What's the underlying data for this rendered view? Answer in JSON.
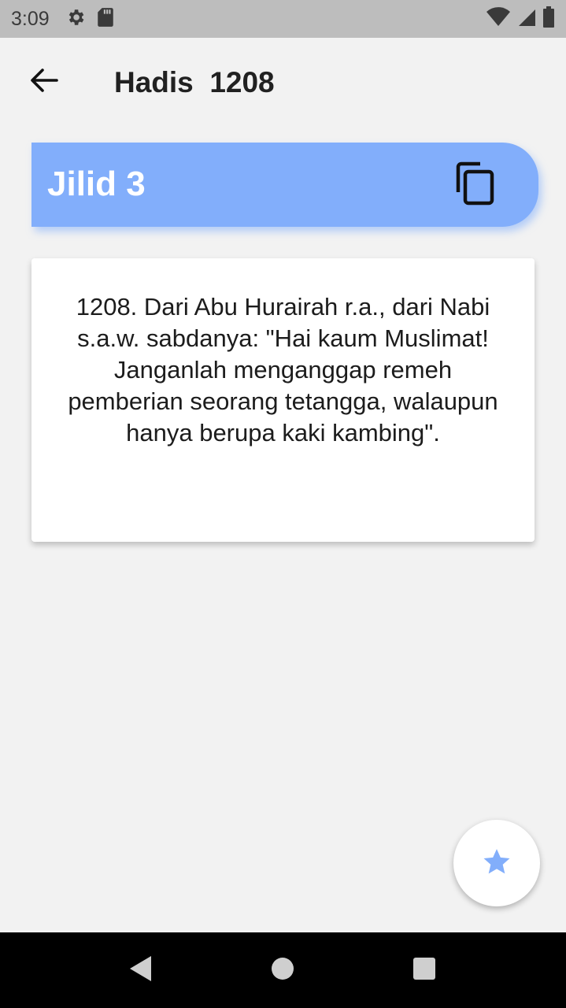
{
  "status_bar": {
    "time": "3:09",
    "left_icons": [
      "gear-icon",
      "sd-card-icon"
    ],
    "right_icons": [
      "wifi-icon",
      "signal-icon",
      "battery-icon"
    ]
  },
  "app_bar": {
    "title": "Hadis  1208",
    "back_icon": "arrow-back-icon"
  },
  "volume_banner": {
    "label": "Jilid 3",
    "copy_icon": "copy-icon",
    "color": "#82aefb"
  },
  "hadith": {
    "text": "1208. Dari Abu Hurairah r.a., dari Nabi s.a.w. sabdanya: \"Hai kaum Muslimat! Janganlah menganggap remeh pemberian seorang tetangga, walaupun hanya berupa kaki kambing\"."
  },
  "fab": {
    "icon": "star-icon",
    "color": "#82aefb"
  },
  "nav_bar": {
    "icons": [
      "back-triangle-icon",
      "home-circle-icon",
      "recents-square-icon"
    ]
  }
}
